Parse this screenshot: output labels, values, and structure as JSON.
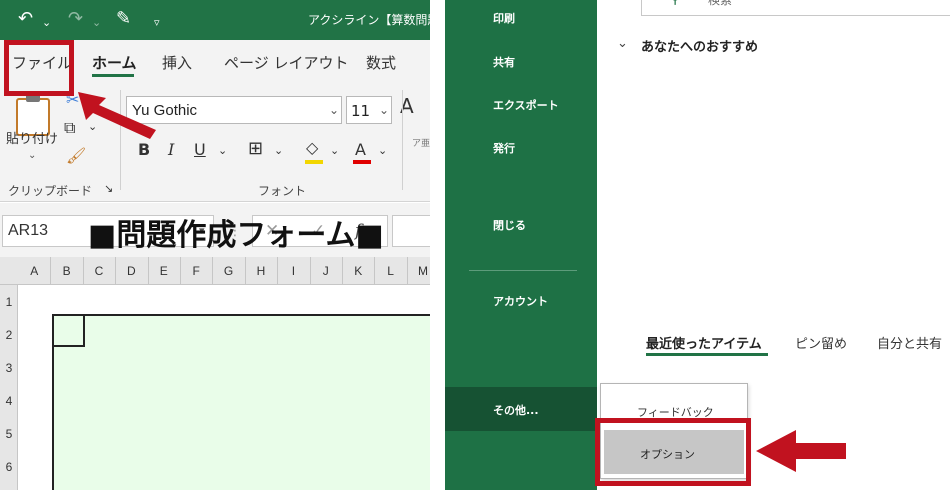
{
  "excel": {
    "window_title": "アクシライン【算数問題",
    "quick_access": {
      "undo_icon": "undo-icon",
      "redo_icon": "redo-icon",
      "touch_mode_icon": "touch-mode-icon",
      "customize_icon": "customize-qat-icon"
    },
    "tabs": [
      {
        "label": "ファイル",
        "active": false
      },
      {
        "label": "ホーム",
        "active": true
      },
      {
        "label": "挿入",
        "active": false
      },
      {
        "label": "ページ レイアウト",
        "active": false
      },
      {
        "label": "数式",
        "active": false
      }
    ],
    "ribbon": {
      "paste_label": "貼り付け",
      "clipboard_group_label": "クリップボード",
      "font_group_label": "フォント",
      "font_name": "Yu Gothic",
      "font_size": "11",
      "bold_label": "B",
      "italic_label": "I",
      "underline_label": "U",
      "font_color_label": "A",
      "grow_font_label": "A"
    },
    "formula_bar": {
      "name_box_value": "AR13",
      "function_label": "fx"
    },
    "sheet": {
      "columns": [
        "A",
        "B",
        "C",
        "D",
        "E",
        "F",
        "G",
        "H",
        "I",
        "J",
        "K",
        "L",
        "M"
      ],
      "rows": [
        "1",
        "2",
        "3",
        "4",
        "5",
        "6"
      ],
      "form_title": "■問題作成フォーム■"
    }
  },
  "backstage": {
    "nav_items": [
      "印刷",
      "共有",
      "エクスポート",
      "発行",
      "閉じる",
      "アカウント",
      "その他..."
    ],
    "search_placeholder": "検索",
    "recommended_title": "あなたへのおすすめ",
    "doc_tabs": [
      {
        "label": "最近使ったアイテム",
        "active": true
      },
      {
        "label": "ピン留め",
        "active": false
      },
      {
        "label": "自分と共有",
        "active": false
      }
    ],
    "more_menu": {
      "feedback_label": "フィードバック",
      "options_label": "オプション"
    }
  },
  "annotation": {
    "highlight_color": "#c1121f",
    "excel_green": "#217346"
  }
}
